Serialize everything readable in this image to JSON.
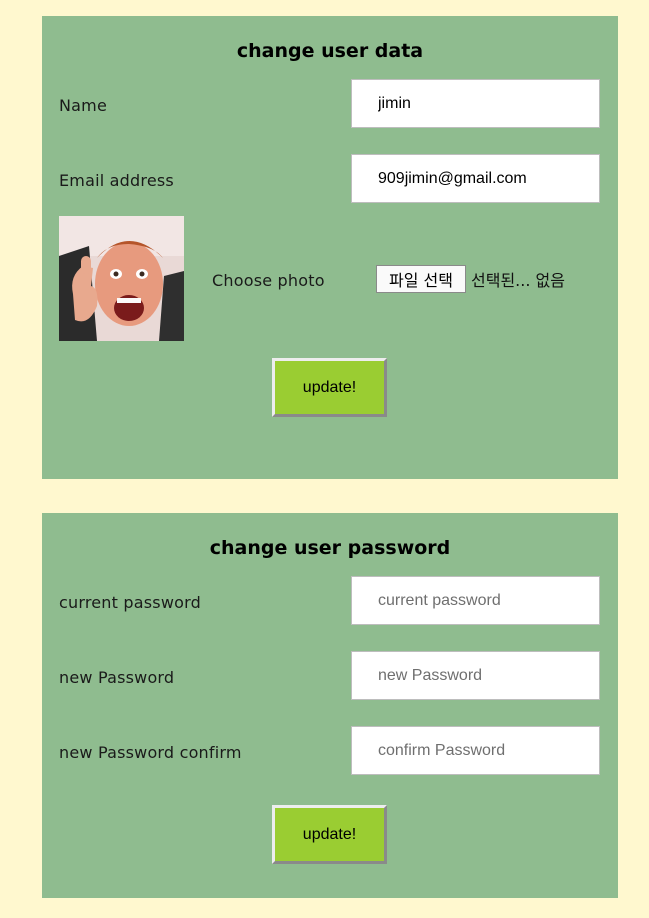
{
  "user_data_panel": {
    "title": "change user data",
    "name_label": "Name",
    "name_value": "jimin",
    "email_label": "Email address",
    "email_value": "909jimin@gmail.com",
    "photo_label": "Choose photo",
    "file_button_label": "파일 선택",
    "file_status": "선택된... 없음",
    "update_label": "update!"
  },
  "password_panel": {
    "title": "change user password",
    "current_label": "current password",
    "current_placeholder": "current password",
    "new_label": "new Password",
    "new_placeholder": "new Password",
    "confirm_label": "new Password confirm",
    "confirm_placeholder": "confirm Password",
    "update_label": "update!"
  },
  "colors": {
    "page_background": "#fff8cf",
    "panel_background": "#8fbc8f",
    "button_background": "#9acd32"
  }
}
